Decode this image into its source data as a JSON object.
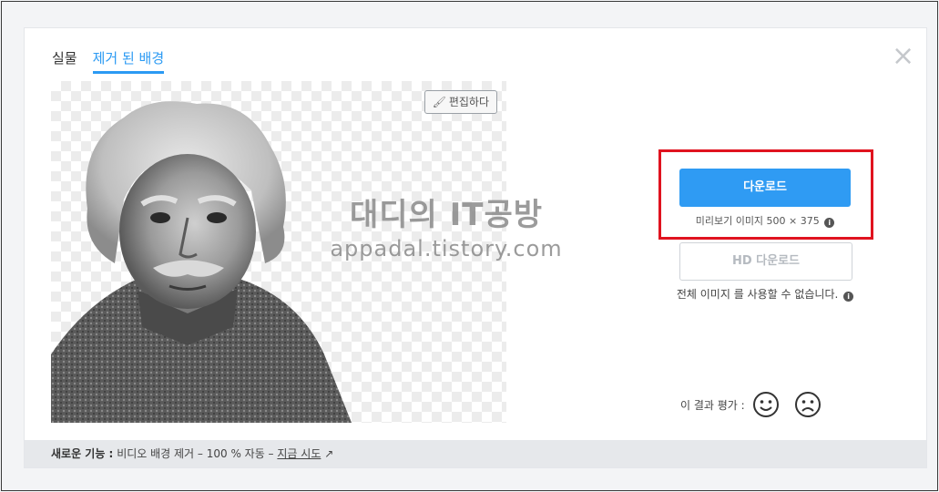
{
  "tabs": [
    {
      "label": "실물"
    },
    {
      "label": "제거 된 배경"
    }
  ],
  "close_symbol": "×",
  "preview": {
    "edit_label": "편집하다",
    "edit_icon": "brush-icon"
  },
  "watermark": {
    "line1": "대디의 IT공방",
    "line2": "appadal.tistory.com"
  },
  "download": {
    "label": "다운로드",
    "note": "미리보기 이미지 500 × 375",
    "info_symbol": "i"
  },
  "hd": {
    "label": "HD 다운로드",
    "note": "전체 이미지 를 사용할 수 없습니다."
  },
  "rating": {
    "label": "이 결과 평가 :"
  },
  "footer": {
    "new_label": "새로운 기능 :",
    "text": "비디오 배경 제거 – 100 % 자동 –",
    "link": "지금 시도"
  },
  "colors": {
    "accent": "#2f9bf3",
    "highlight": "#e0131f"
  }
}
